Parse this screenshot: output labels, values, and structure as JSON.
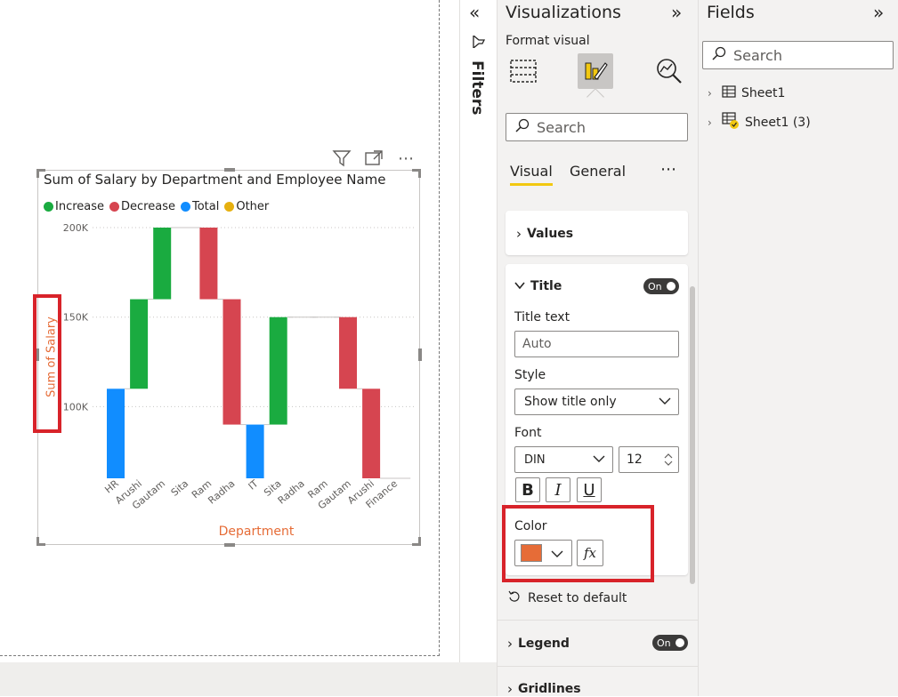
{
  "chart_data": {
    "type": "waterfall",
    "title": "Sum of Salary by Department and Employee Name",
    "xlabel": "Department",
    "ylabel": "Sum of Salary",
    "yticks": [
      "100K",
      "150K",
      "200K"
    ],
    "ylim": [
      60000,
      210000
    ],
    "legend": [
      {
        "label": "Increase",
        "color": "#1aab40"
      },
      {
        "label": "Decrease",
        "color": "#d64550"
      },
      {
        "label": "Total",
        "color": "#118dff"
      },
      {
        "label": "Other",
        "color": "#e6b00f"
      }
    ],
    "categories": [
      "HR",
      "Arushi",
      "Gautam",
      "Sita",
      "Ram",
      "Radha",
      "IT",
      "Sita",
      "Radha",
      "Ram",
      "Gautam",
      "Arushi",
      "Finance"
    ],
    "bars": [
      {
        "kind": "Total",
        "start": 60000,
        "end": 110000
      },
      {
        "kind": "Increase",
        "start": 110000,
        "end": 160000
      },
      {
        "kind": "Increase",
        "start": 160000,
        "end": 200000
      },
      {
        "kind": "Flat",
        "start": 200000,
        "end": 200000
      },
      {
        "kind": "Decrease",
        "start": 200000,
        "end": 160000
      },
      {
        "kind": "Decrease",
        "start": 160000,
        "end": 90000
      },
      {
        "kind": "Total",
        "start": 60000,
        "end": 90000
      },
      {
        "kind": "Increase",
        "start": 90000,
        "end": 150000
      },
      {
        "kind": "Flat",
        "start": 150000,
        "end": 150000
      },
      {
        "kind": "Flat",
        "start": 150000,
        "end": 150000
      },
      {
        "kind": "Decrease",
        "start": 150000,
        "end": 110000
      },
      {
        "kind": "Decrease",
        "start": 110000,
        "end": 60000
      },
      {
        "kind": "Flat",
        "start": 60000,
        "end": 60000
      }
    ]
  },
  "filters": {
    "label": "Filters"
  },
  "visualizations": {
    "title": "Visualizations",
    "format_visual_label": "Format visual",
    "search_placeholder": "Search",
    "tabs": {
      "visual": "Visual",
      "general": "General",
      "more": "⋯"
    },
    "values_section": "Values",
    "title_section": {
      "label": "Title",
      "toggle": "On",
      "title_text_label": "Title text",
      "title_text_value": "Auto",
      "style_label": "Style",
      "style_value": "Show title only",
      "font_label": "Font",
      "font_family": "DIN",
      "font_size": "12",
      "bold": "B",
      "italic": "I",
      "underline": "U",
      "color_label": "Color",
      "color_value": "#e66c37",
      "fx_label": "fx"
    },
    "reset_label": "Reset to default",
    "legend_section": {
      "label": "Legend",
      "toggle": "On"
    },
    "gridlines_section": {
      "label": "Gridlines"
    }
  },
  "fields": {
    "title": "Fields",
    "search_placeholder": "Search",
    "tables": [
      "Sheet1",
      "Sheet1 (3)"
    ]
  }
}
